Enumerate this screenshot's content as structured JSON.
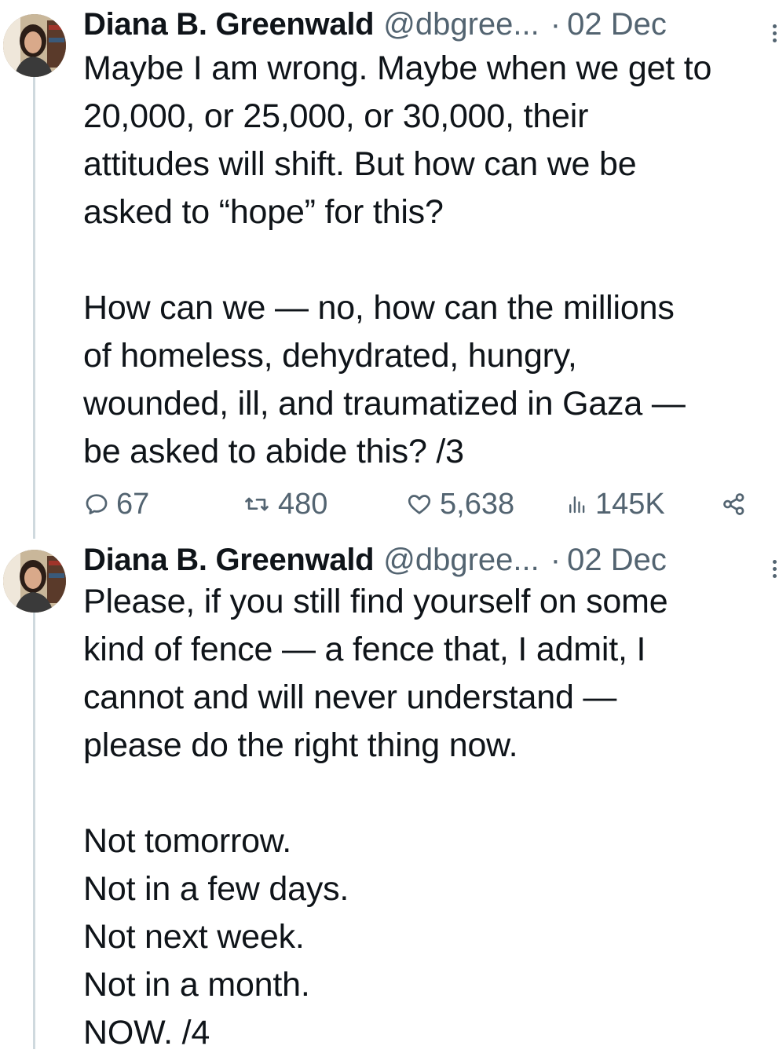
{
  "tweets": [
    {
      "author_name": "Diana B. Greenwald",
      "handle": "@dbgree...",
      "separator": "·",
      "date": "02 Dec",
      "paragraph1": [
        "Maybe I am wrong. Maybe when we get to",
        "20,000, or 25,000, or 30,000, their",
        "attitudes will shift. But how can we be",
        "asked to “hope” for this?"
      ],
      "paragraph2": [
        "How can we — no, how can the millions",
        "of homeless, dehydrated, hungry,",
        "wounded, ill, and traumatized in Gaza —",
        "be asked to abide this? /3"
      ],
      "replies": "67",
      "reposts": "480",
      "likes": "5,638",
      "views": "145K"
    },
    {
      "author_name": "Diana B. Greenwald",
      "handle": "@dbgree...",
      "separator": "·",
      "date": "02 Dec",
      "paragraph1": [
        "Please, if you still find yourself on some",
        "kind of fence — a fence that, I admit, I",
        "cannot and will never understand —",
        "please do the right thing now."
      ],
      "paragraph2": [
        "Not tomorrow.",
        "Not in a few days.",
        "Not next week.",
        "Not in a month.",
        "NOW. /4"
      ]
    }
  ],
  "icons": {
    "reply": "reply-icon",
    "repost": "repost-icon",
    "like": "heart-icon",
    "views": "views-icon",
    "share": "share-icon",
    "more": "more-icon"
  },
  "colors": {
    "text": "#0f1419",
    "secondary": "#536471",
    "thread_line": "#cfd9de"
  }
}
